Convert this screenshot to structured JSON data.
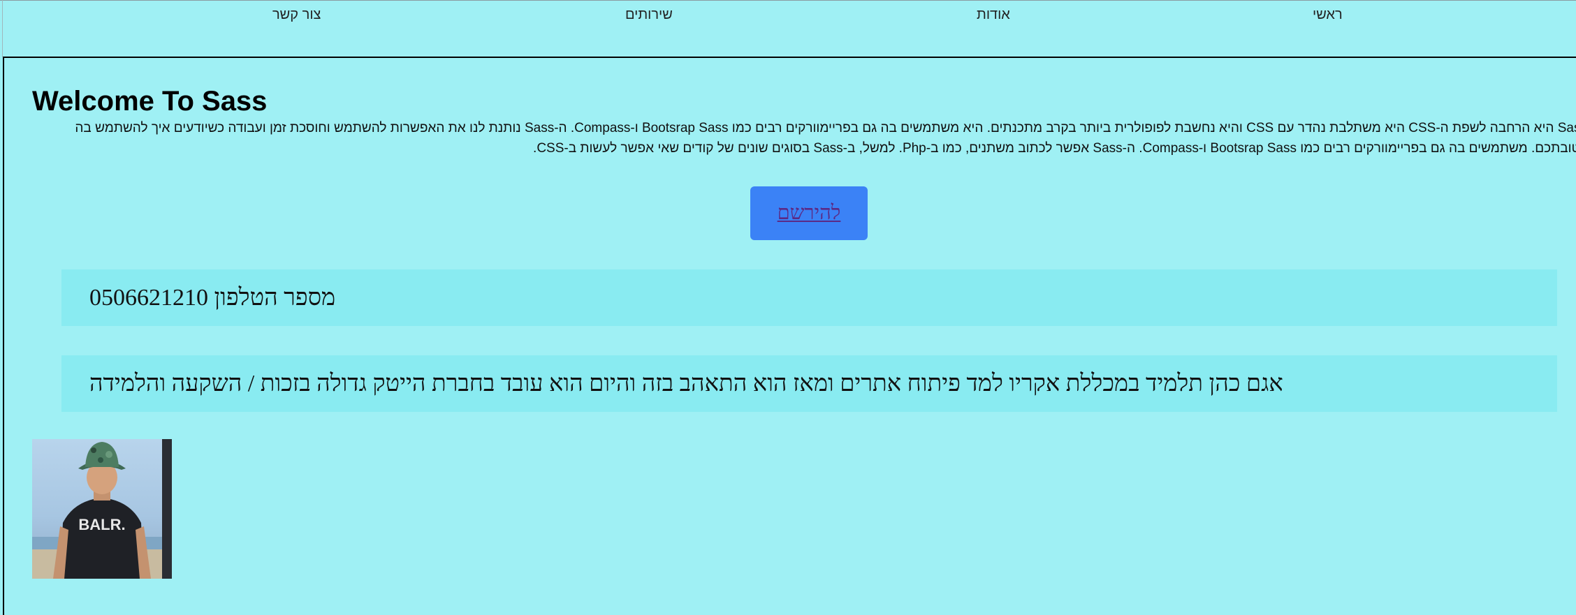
{
  "nav": {
    "items": [
      {
        "label": "ראשי"
      },
      {
        "label": "אודות"
      },
      {
        "label": "שירותים"
      },
      {
        "label": "צור קשר"
      }
    ]
  },
  "main": {
    "title": "Welcome To Sass",
    "paragraph": "Sass היא הרחבה לשפת ה-CSS היא משתלבת נהדר עם CSS והיא נחשבת לפופולרית ביותר בקרב מתכנתים. היא משתמשים בה גם בפריימוורקים רבים כמו Bootsrap Sass ו-Compass. ה-Sass נותנת לנו את האפשרות להשתמש וחוסכת זמן ועבודה כשיודעים איך להשתמש בה לטובתכם. משתמשים בה גם בפריימוורקים רבים כמו Bootsrap Sass ו-Compass. ה-Sass אפשר לכתוב משתנים, כמו ב-Php. למשל, ב-Sass בסוגים שונים של קודים שאי אפשר לעשות ב-CSS.",
    "register_label": "להירשם",
    "phone_text": "מספר הטלפון 0506621210",
    "bio_text": "אגם כהן תלמיד במכללת אקריו למד פיתוח אתרים ומאז הוא התאהב בזה והיום הוא עובד בחברת הייטק גדולה בזכות / השקעה והלמידה",
    "photo_shirt_text": "BALR."
  },
  "colors": {
    "page_background": "#9ff0f4",
    "card_background": "#89ebf1",
    "button_background": "#3b82f6",
    "link_color": "#5b2a86"
  }
}
